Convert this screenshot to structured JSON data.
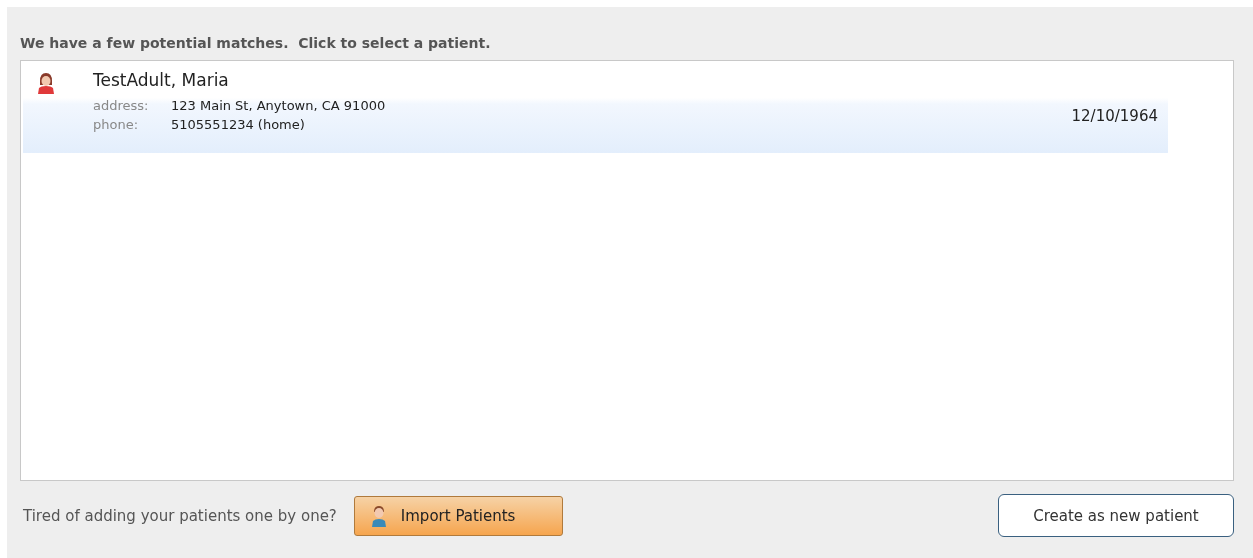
{
  "heading": "We have a few potential matches.  Click to select a patient.",
  "patients": [
    {
      "name": "TestAdult, Maria",
      "selected": true,
      "address_label": "address:",
      "address": "123 Main St, Anytown, CA 91000",
      "phone_label": "phone:",
      "phone": "5105551234 (home)",
      "birth_date": "12/10/1964"
    }
  ],
  "footer": {
    "prompt": "Tired of adding your patients one by one?",
    "import_button": "Import Patients",
    "create_button": "Create as new patient"
  }
}
